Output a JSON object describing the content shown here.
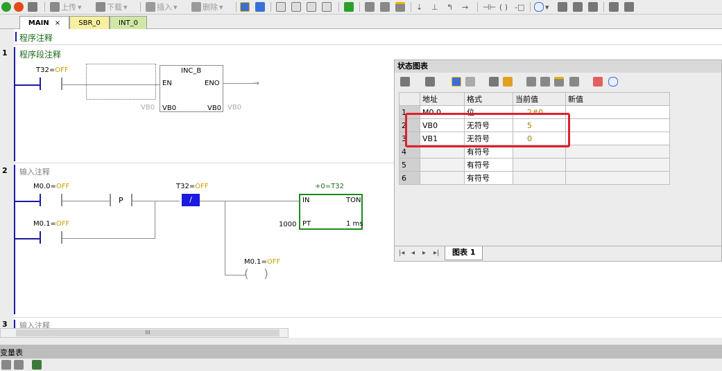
{
  "toolbar": {
    "upload_label": "上传",
    "download_label": "下载",
    "insert_label": "插入",
    "delete_label": "删除"
  },
  "tabs": [
    {
      "label": "MAIN",
      "close": "×"
    },
    {
      "label": "SBR_0"
    },
    {
      "label": "INT_0"
    }
  ],
  "editor": {
    "program_comment": "程序注释",
    "network1": {
      "number": "1",
      "comment": "程序段注释",
      "contact": "T32=OFF",
      "box_title": "INC_B",
      "en": "EN",
      "eno": "ENO",
      "in_left": "VB0",
      "in_pin": "VB0",
      "out_pin": "VB0",
      "out_right": "VB0"
    },
    "network2": {
      "number": "2",
      "comment": "输入注释",
      "c1": "M0.0=OFF",
      "p": "P",
      "c3": "T32=OFF",
      "not": "/",
      "c2": "M0.1=OFF",
      "timer_top": "+0=T32",
      "in": "IN",
      "ton": "TON",
      "pt_val": "1000",
      "pt": "PT",
      "res": "1 ms",
      "coil": "M0.1=OFF"
    },
    "network3": {
      "number": "3",
      "comment": "输入注释"
    },
    "scroll_thumb": "III"
  },
  "bottom": {
    "panel_title": "变量表"
  },
  "status_chart": {
    "title": "状态图表",
    "headers": [
      "地址",
      "格式",
      "当前值",
      "新值"
    ],
    "rows": [
      {
        "n": "1",
        "addr": "M0.0",
        "fmt": "位",
        "cur": "2#0",
        "new": ""
      },
      {
        "n": "2",
        "addr": "VB0",
        "fmt": "无符号",
        "cur": "5",
        "new": ""
      },
      {
        "n": "3",
        "addr": "VB1",
        "fmt": "无符号",
        "cur": "0",
        "new": ""
      },
      {
        "n": "4",
        "addr": "",
        "fmt": "有符号",
        "cur": "",
        "new": ""
      },
      {
        "n": "5",
        "addr": "",
        "fmt": "有符号",
        "cur": "",
        "new": ""
      },
      {
        "n": "6",
        "addr": "",
        "fmt": "有符号",
        "cur": "",
        "new": ""
      }
    ],
    "sheet_tab": "图表 1"
  }
}
